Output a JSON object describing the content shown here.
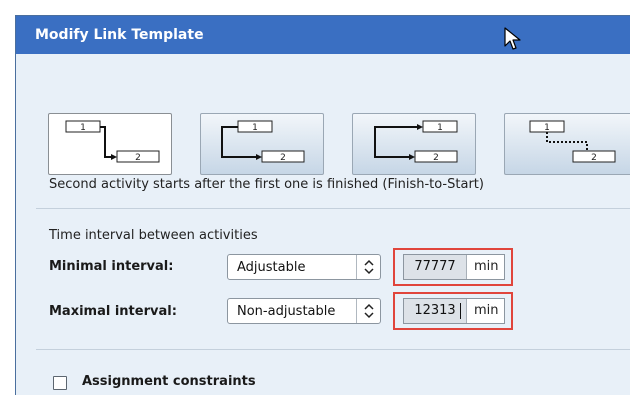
{
  "dialog": {
    "title": "Modify Link Template"
  },
  "link_types": [
    {
      "id": "finish-to-start",
      "first": "1",
      "second": "2",
      "selected": true
    },
    {
      "id": "start-to-start",
      "first": "1",
      "second": "2",
      "selected": false
    },
    {
      "id": "finish-to-finish",
      "first": "1",
      "second": "2",
      "selected": false
    },
    {
      "id": "dotted-link",
      "first": "1",
      "second": "2",
      "selected": false
    }
  ],
  "description": "Second activity starts after the first one is finished (Finish-to-Start)",
  "interval": {
    "section_label": "Time interval between activities",
    "minimal": {
      "label": "Minimal interval:",
      "mode": "Adjustable",
      "value": "77777",
      "unit": "min"
    },
    "maximal": {
      "label": "Maximal interval:",
      "mode": "Non-adjustable",
      "value": "12313",
      "unit": "min"
    }
  },
  "assignment": {
    "label": "Assignment constraints",
    "checked": false
  },
  "colors": {
    "title_bar": "#3a6fc2",
    "panel": "#e8f0f8",
    "highlight": "#e0453c"
  }
}
